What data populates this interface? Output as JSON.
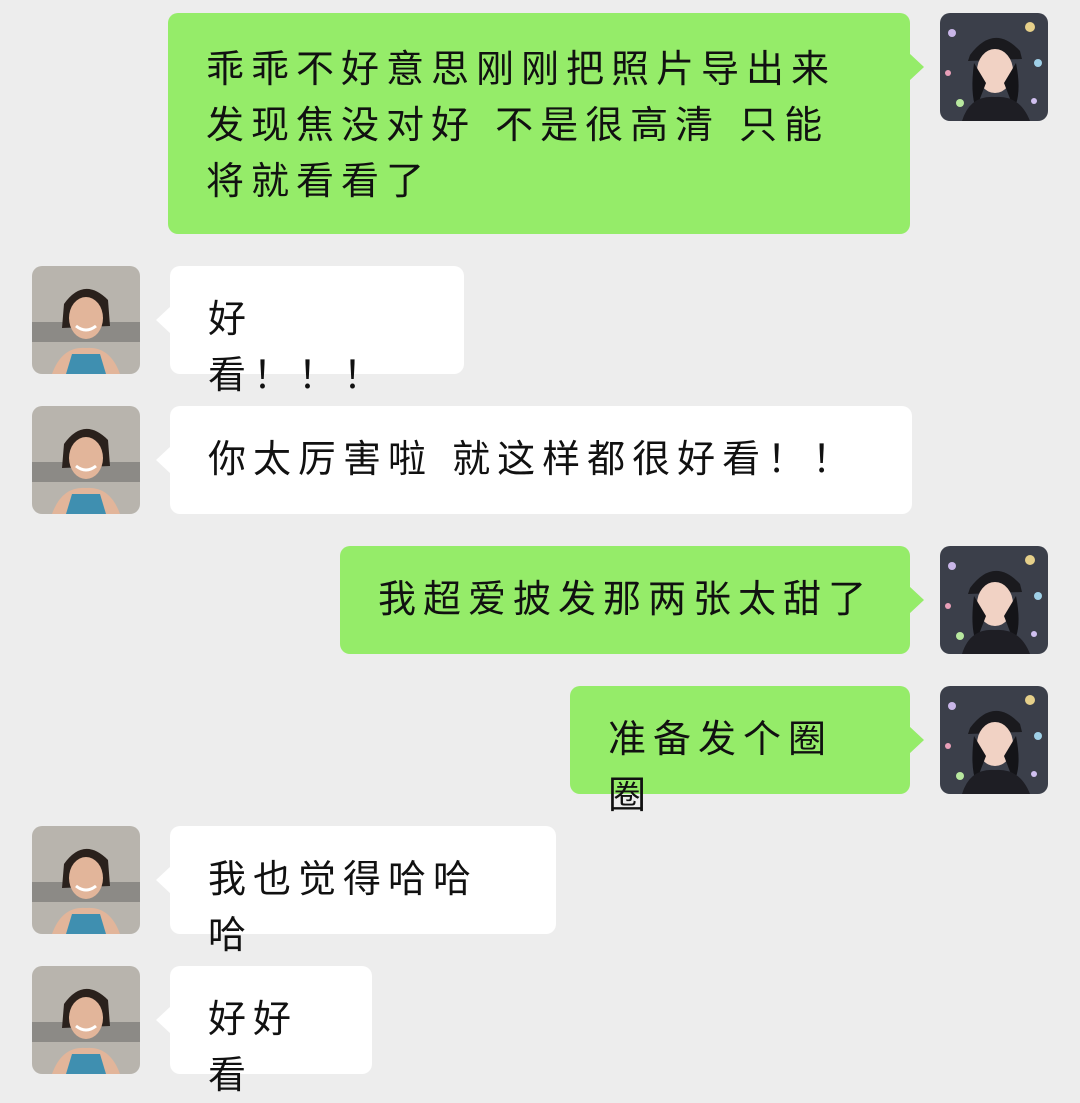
{
  "messages": [
    {
      "sender": "self",
      "text": "乖乖不好意思刚刚把照片导出来发现焦没对好 不是很高清  只能将就看看了"
    },
    {
      "sender": "other",
      "text": "好看！！！"
    },
    {
      "sender": "other",
      "text": "你太厉害啦 就这样都很好看！！"
    },
    {
      "sender": "self",
      "text": "我超爱披发那两张太甜了"
    },
    {
      "sender": "self",
      "text": "准备发个圈圈"
    },
    {
      "sender": "other",
      "text": "我也觉得哈哈哈"
    },
    {
      "sender": "other",
      "text": "好好看"
    }
  ],
  "avatars": {
    "self": "avatar-self-photo",
    "other": "avatar-contact-photo"
  },
  "colors": {
    "background": "#ededed",
    "self_bubble": "#95ec69",
    "other_bubble": "#ffffff",
    "text": "#111111"
  }
}
